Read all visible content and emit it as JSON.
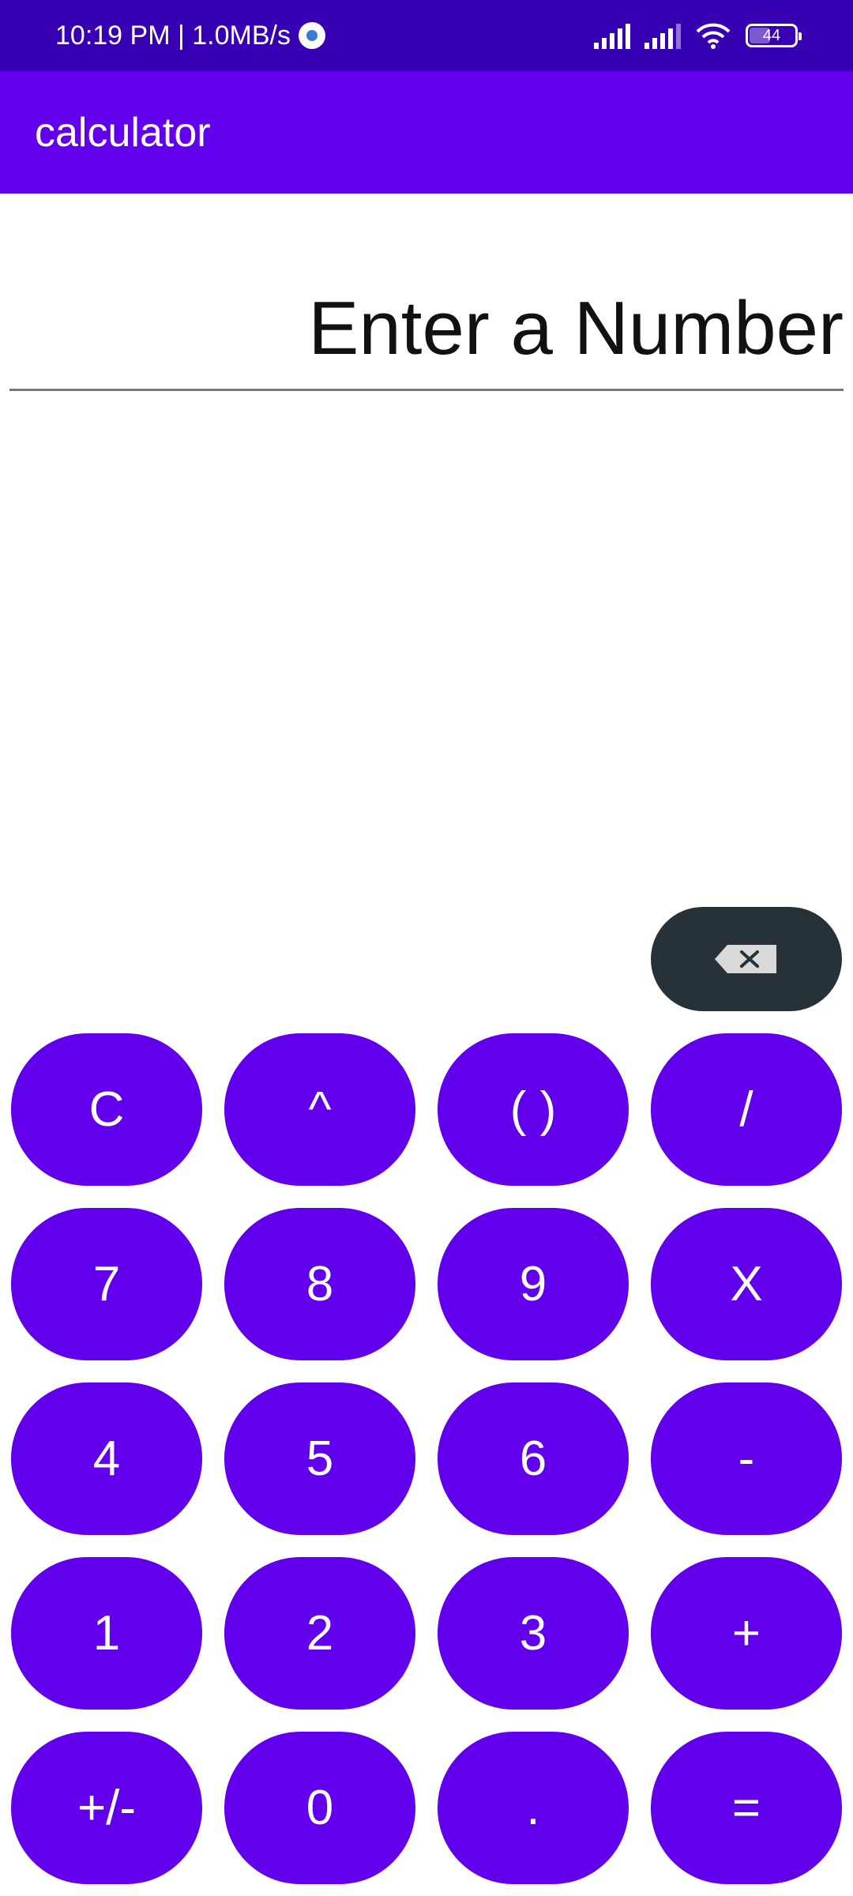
{
  "status_bar": {
    "time_speed": "10:19 PM | 1.0MB/s",
    "battery": "44",
    "icons": [
      "settings-dot-icon",
      "signal-icon",
      "signal-icon",
      "wifi-icon",
      "battery-icon"
    ]
  },
  "app_bar": {
    "title": "calculator"
  },
  "display": {
    "placeholder": "Enter a Number",
    "value": ""
  },
  "backspace": {
    "icon": "backspace-icon"
  },
  "keys": [
    {
      "id": "clear",
      "label": "C"
    },
    {
      "id": "power",
      "label": "^"
    },
    {
      "id": "parentheses",
      "label": "( )"
    },
    {
      "id": "divide",
      "label": "/"
    },
    {
      "id": "7",
      "label": "7"
    },
    {
      "id": "8",
      "label": "8"
    },
    {
      "id": "9",
      "label": "9"
    },
    {
      "id": "multiply",
      "label": "X"
    },
    {
      "id": "4",
      "label": "4"
    },
    {
      "id": "5",
      "label": "5"
    },
    {
      "id": "6",
      "label": "6"
    },
    {
      "id": "minus",
      "label": "-"
    },
    {
      "id": "1",
      "label": "1"
    },
    {
      "id": "2",
      "label": "2"
    },
    {
      "id": "3",
      "label": "3"
    },
    {
      "id": "plus",
      "label": "+"
    },
    {
      "id": "negate",
      "label": "+/-"
    },
    {
      "id": "0",
      "label": "0"
    },
    {
      "id": "decimal",
      "label": "."
    },
    {
      "id": "equals",
      "label": "="
    }
  ],
  "colors": {
    "status_bar": "#3700b3",
    "primary": "#6200ee",
    "backspace_bg": "#263238",
    "key_text": "#ffffff"
  }
}
